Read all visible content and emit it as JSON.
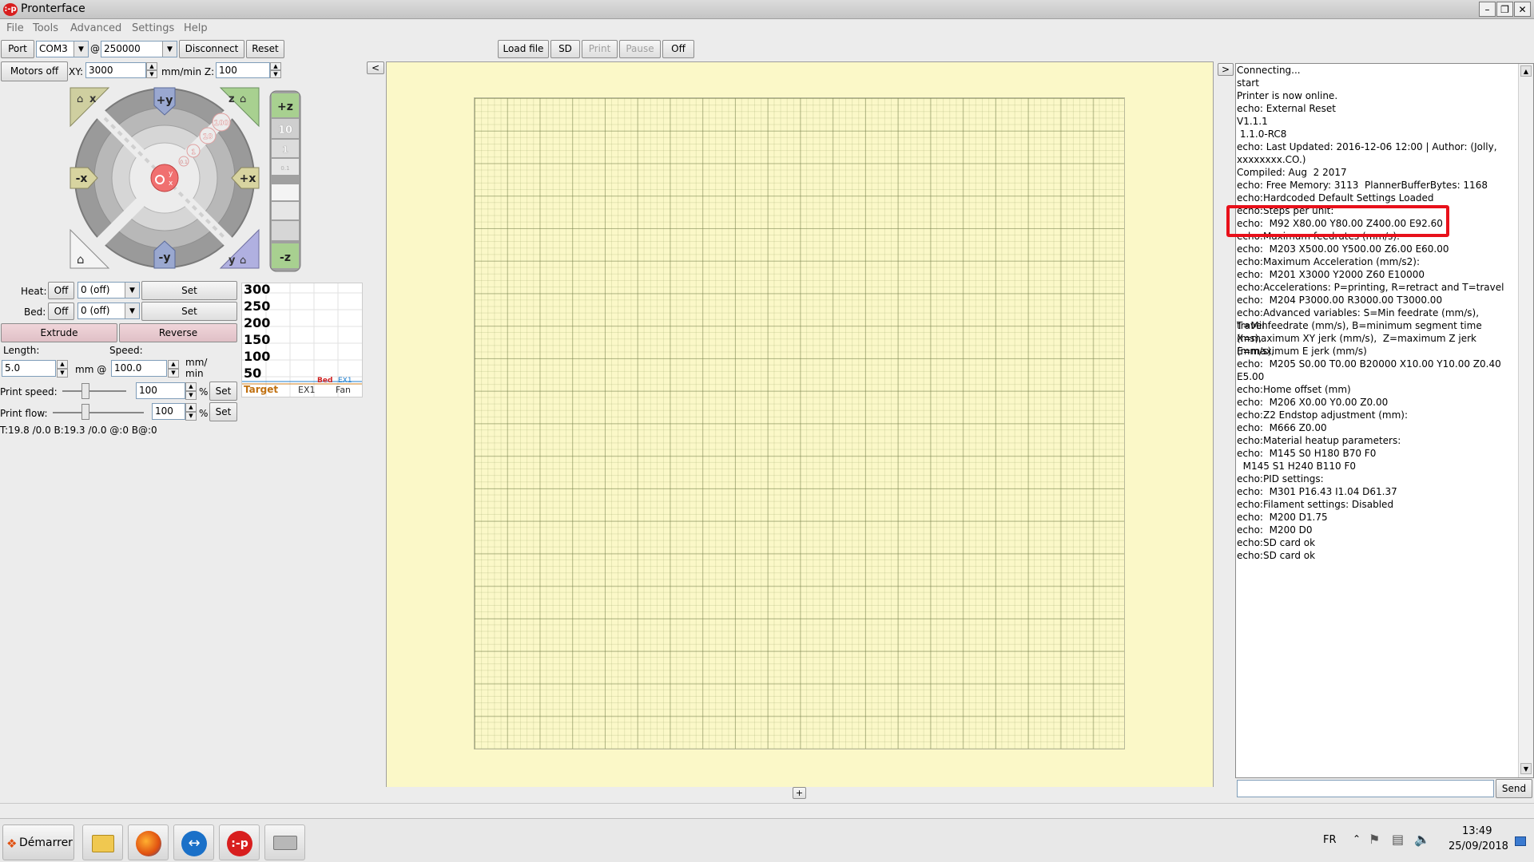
{
  "window": {
    "title": "Pronterface",
    "icon_label": ":-p"
  },
  "menu": [
    "File",
    "Tools",
    "Advanced",
    "Settings",
    "Help"
  ],
  "toolbar": {
    "port_label": "Port",
    "port_value": "COM3",
    "at_symbol": "@",
    "baud_value": "250000",
    "disconnect_label": "Disconnect",
    "reset_label": "Reset",
    "load_file_label": "Load file",
    "sd_label": "SD",
    "print_label": "Print",
    "pause_label": "Pause",
    "off_label": "Off"
  },
  "motion": {
    "motors_off_label": "Motors off",
    "xy_label": "XY:",
    "xy_speed": "3000",
    "z_label": "mm/min Z:",
    "z_speed": "100",
    "jog": {
      "home_x": "x",
      "plus_y": "+y",
      "home_z": "z",
      "minus_x": "-x",
      "plus_x": "+x",
      "minus_y": "-y",
      "home_y": "y",
      "step_100": "100",
      "step_10": "10",
      "step_1": "1",
      "step_01": "0.1",
      "center_y": "y",
      "center_x": "x"
    },
    "z_jog": {
      "plus_z": "+z",
      "step_10": "10",
      "step_1": "1",
      "step_01": "0.1",
      "minus_z": "-z"
    }
  },
  "temperature": {
    "heat_label": "Heat:",
    "heat_off": "Off",
    "heat_value": "0 (off)",
    "heat_set": "Set",
    "bed_label": "Bed:",
    "bed_off": "Off",
    "bed_value": "0 (off)",
    "bed_set": "Set"
  },
  "extrusion": {
    "extrude_label": "Extrude",
    "reverse_label": "Reverse",
    "length_label": "Length:",
    "speed_label": "Speed:",
    "length_value": "5.0",
    "length_unit": "mm @",
    "speed_value": "100.0",
    "speed_unit": "mm/\nmin",
    "print_speed_label": "Print speed:",
    "print_speed_value": "100",
    "print_speed_unit": "%",
    "print_speed_set": "Set",
    "print_flow_label": "Print flow:",
    "print_flow_value": "100",
    "print_flow_unit": "%",
    "print_flow_set": "Set"
  },
  "status_temps": "T:19.8 /0.0 B:19.3 /0.0 @:0 B@:0",
  "temp_graph": {
    "ticks": [
      "300",
      "250",
      "200",
      "150",
      "100",
      "50"
    ],
    "legend": [
      "Target",
      "EX1",
      "Fan"
    ],
    "legend_small": [
      "Bed",
      "EX1"
    ]
  },
  "plater": {
    "collapse_left": "<",
    "collapse_right": ">",
    "add_button": "+"
  },
  "console": {
    "lines": [
      "Connecting...",
      "start",
      "Printer is now online.",
      "echo: External Reset",
      "V1.1.1",
      " 1.1.0-RC8",
      "echo: Last Updated: 2016-12-06 12:00 | Author: (Jolly,",
      "xxxxxxxx.CO.)",
      "Compiled: Aug  2 2017",
      "echo: Free Memory: 3113  PlannerBufferBytes: 1168",
      "echo:Hardcoded Default Settings Loaded",
      "echo:Steps per unit:",
      "echo:  M92 X80.00 Y80.00 Z400.00 E92.60",
      "echo:Maximum feedrates (mm/s):",
      "echo:  M203 X500.00 Y500.00 Z6.00 E60.00",
      "echo:Maximum Acceleration (mm/s2):",
      "echo:  M201 X3000 Y2000 Z60 E10000",
      "echo:Accelerations: P=printing, R=retract and T=travel",
      "echo:  M204 P3000.00 R3000.00 T3000.00",
      "echo:Advanced variables: S=Min feedrate (mm/s), T=Min",
      "travel feedrate (mm/s), B=minimum segment time (ms),",
      "X=maximum XY jerk (mm/s),  Z=maximum Z jerk (mm/s),",
      "E=maximum E jerk (mm/s)",
      "echo:  M205 S0.00 T0.00 B20000 X10.00 Y10.00 Z0.40",
      "E5.00",
      "echo:Home offset (mm)",
      "echo:  M206 X0.00 Y0.00 Z0.00",
      "echo:Z2 Endstop adjustment (mm):",
      "echo:  M666 Z0.00",
      "echo:Material heatup parameters:",
      "echo:  M145 S0 H180 B70 F0",
      "  M145 S1 H240 B110 F0",
      "echo:PID settings:",
      "echo:  M301 P16.43 I1.04 D61.37",
      "echo:Filament settings: Disabled",
      "echo:  M200 D1.75",
      "echo:  M200 D0",
      "echo:SD card ok",
      "echo:SD card ok"
    ],
    "command_value": "",
    "send_label": "Send",
    "highlight_color": "#e8101a"
  },
  "taskbar": {
    "start_label": "Démarrer",
    "lang": "FR",
    "time": "13:49",
    "date": "25/09/2018",
    "pronterface_icon": ":-p"
  }
}
